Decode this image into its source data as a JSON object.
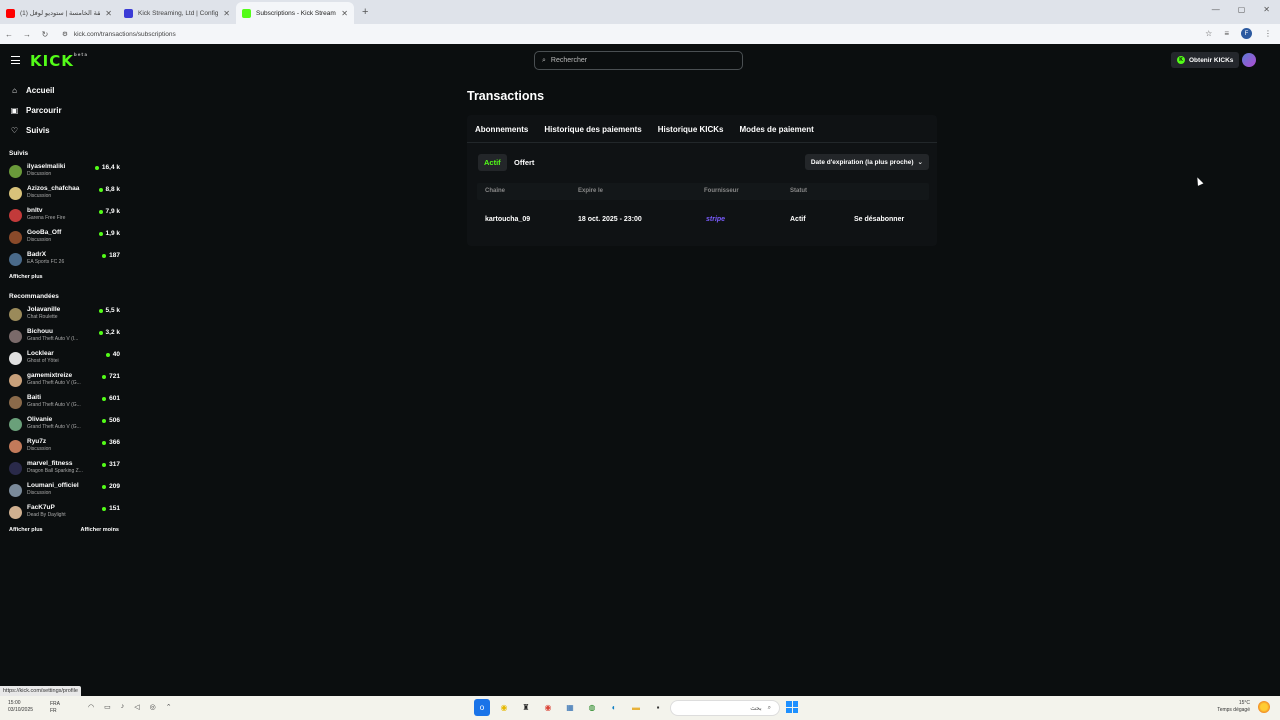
{
  "browser": {
    "tabs": [
      {
        "title": "(1) الحلقة الخامسة | ستوديو لوفل",
        "color": "#ff0000"
      },
      {
        "title": "Kick Streaming, Ltd | Configur...",
        "color": "#3b3bd6"
      },
      {
        "title": "Subscriptions - Kick Streaming",
        "color": "#53fc18"
      }
    ],
    "new_tab": "+",
    "url": "kick.com/transactions/subscriptions",
    "profile_initial": "F"
  },
  "header": {
    "logo": "KICK",
    "logo_beta": "beta",
    "search_placeholder": "Rechercher",
    "get_kicks_label": "Obtenir KICKs"
  },
  "sidebar": {
    "nav": [
      {
        "icon": "⌂",
        "label": "Accueil"
      },
      {
        "icon": "▣",
        "label": "Parcourir"
      },
      {
        "icon": "♡",
        "label": "Suivis"
      }
    ],
    "followed_title": "Suivis",
    "followed": [
      {
        "name": "ilyaselmaliki",
        "category": "Discussion",
        "viewers": "16,4 k",
        "color": "#6a9a3a"
      },
      {
        "name": "Azizos_chafchaa",
        "category": "Discussion",
        "viewers": "8,8 k",
        "color": "#d8c27a"
      },
      {
        "name": "bnltv",
        "category": "Garena Free Fire",
        "viewers": "7,9 k",
        "color": "#c23a3a"
      },
      {
        "name": "GooBa_Off",
        "category": "Discussion",
        "viewers": "1,9 k",
        "color": "#8a4a2a"
      },
      {
        "name": "BadrX",
        "category": "EA Sports FC 26",
        "viewers": "187",
        "color": "#4a6a8a"
      }
    ],
    "followed_more": "Afficher plus",
    "recommended_title": "Recommandées",
    "recommended": [
      {
        "name": "Jolavanille",
        "category": "Chat Roulette",
        "viewers": "5,5 k",
        "color": "#9a8a5a"
      },
      {
        "name": "Bichouu",
        "category": "Grand Theft Auto V (I...",
        "viewers": "3,2 k",
        "color": "#7a6a6a"
      },
      {
        "name": "Locklear",
        "category": "Ghost of Yōtei",
        "viewers": "40",
        "color": "#e0e0e0"
      },
      {
        "name": "gamemixtreize",
        "category": "Grand Theft Auto V (G...",
        "viewers": "721",
        "color": "#c8a07a"
      },
      {
        "name": "Baiti",
        "category": "Grand Theft Auto V (G...",
        "viewers": "601",
        "color": "#8a6a4a"
      },
      {
        "name": "Olivanie",
        "category": "Grand Theft Auto V (G...",
        "viewers": "506",
        "color": "#6aa07a"
      },
      {
        "name": "Ryu7z",
        "category": "Discussion",
        "viewers": "366",
        "color": "#c27a5a"
      },
      {
        "name": "marvel_fitness",
        "category": "Dragon Ball Sparking Z...",
        "viewers": "317",
        "color": "#2a2a4a"
      },
      {
        "name": "Loumani_officiel",
        "category": "Discussion",
        "viewers": "209",
        "color": "#7a8a9a"
      },
      {
        "name": "FacK7uP",
        "category": "Dead By Daylight",
        "viewers": "151",
        "color": "#d0b090"
      }
    ],
    "recommended_more": "Afficher plus",
    "recommended_less": "Afficher moins"
  },
  "main": {
    "title": "Transactions",
    "tabs": [
      "Abonnements",
      "Historique des paiements",
      "Historique KICKs",
      "Modes de paiement"
    ],
    "filters": {
      "active": "Actif",
      "other": "Offert"
    },
    "sort_label": "Date d'expiration (la plus proche)",
    "columns": [
      "Chaîne",
      "Expire le",
      "Fournisseur",
      "Statut"
    ],
    "rows": [
      {
        "channel": "kartoucha_09",
        "expires": "18 oct. 2025 - 23:00",
        "provider": "stripe",
        "status": "Actif",
        "action": "Se désabonner"
      }
    ]
  },
  "status_url": "https://kick.com/settings/profile",
  "taskbar": {
    "time": "15:00",
    "date": "03/10/2025",
    "lang": "FRA",
    "lang2": "FR",
    "search_placeholder": "بحث",
    "weather_temp": "15°C",
    "weather_desc": "Temps dégagé"
  }
}
